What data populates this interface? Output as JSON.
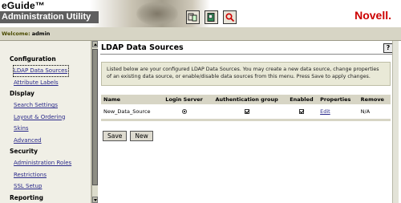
{
  "header": {
    "app_name": "eGuide™",
    "subtitle": "Administration Utility",
    "brand": "Novell.",
    "tools": [
      "admin-tool-icon",
      "book-icon",
      "search-icon"
    ]
  },
  "welcome": {
    "label": "Welcome:",
    "user": "admin"
  },
  "sidebar": {
    "sections": [
      {
        "title": "Configuration",
        "items": [
          "LDAP Data Sources",
          "Attribute Labels"
        ]
      },
      {
        "title": "Display",
        "items": [
          "Search Settings",
          "Layout & Ordering",
          "Skins",
          "Advanced"
        ]
      },
      {
        "title": "Security",
        "items": [
          "Administration Roles",
          "Restrictions",
          "SSL Setup"
        ]
      },
      {
        "title": "Reporting",
        "items": []
      }
    ]
  },
  "main": {
    "title": "LDAP Data Sources",
    "help": "?",
    "intro": "Listed below are your configured LDAP Data Sources. You may create a new data source, change properties of an existing data source, or enable/disable data sources from this menu. Press Save to apply changes.",
    "table": {
      "headers": [
        "Name",
        "Login Server",
        "Authentication group",
        "Enabled",
        "Properties",
        "Remove"
      ],
      "rows": [
        {
          "name": "New_Data_Source",
          "login_server": true,
          "auth_group": true,
          "enabled": true,
          "properties": "Edit",
          "remove": "N/A"
        }
      ]
    },
    "buttons": {
      "save": "Save",
      "new": "New"
    }
  }
}
